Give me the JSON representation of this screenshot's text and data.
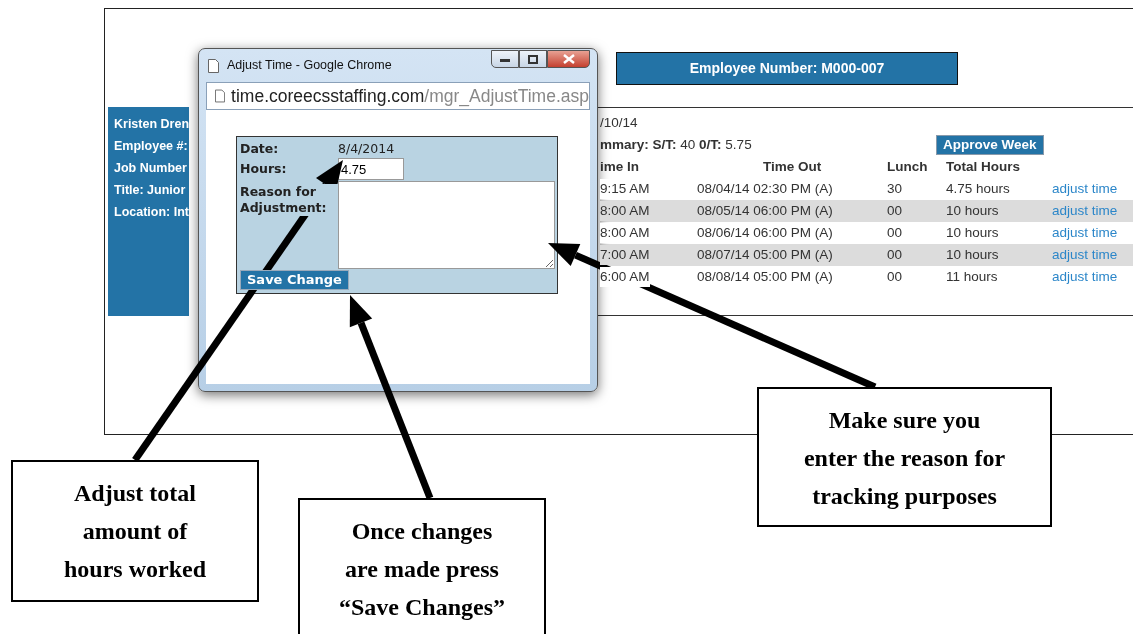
{
  "employee_number": "Employee Number: M000-007",
  "sidebar": {
    "lines": [
      "Kristen Dren",
      "Employee #:",
      "Job Number",
      "Title: Junior",
      "Location: Int"
    ]
  },
  "week": {
    "date_end": "/10/14",
    "summary": "**mmary: S/T:** 40 **0/T:** 5.75",
    "approve_button": "Approve Week",
    "columns": [
      "ime In",
      "Time Out",
      "Lunch",
      "Total Hours"
    ],
    "rows": [
      {
        "time_in": "9:15 AM",
        "time_out": "08/04/14 02:30 PM (A)",
        "lunch": "30",
        "total": "4.75 hours",
        "action": "adjust time"
      },
      {
        "time_in": "8:00 AM",
        "time_out": "08/05/14 06:00 PM (A)",
        "lunch": "00",
        "total": "10 hours",
        "action": "adjust time"
      },
      {
        "time_in": "8:00 AM",
        "time_out": "08/06/14 06:00 PM (A)",
        "lunch": "00",
        "total": "10 hours",
        "action": "adjust time"
      },
      {
        "time_in": "7:00 AM",
        "time_out": "08/07/14 05:00 PM (A)",
        "lunch": "00",
        "total": "10 hours",
        "action": "adjust time"
      },
      {
        "time_in": "6:00 AM",
        "time_out": "08/08/14 05:00 PM (A)",
        "lunch": "00",
        "total": "11 hours",
        "action": "adjust time"
      }
    ]
  },
  "popup": {
    "title": "Adjust Time - Google Chrome",
    "url_host": "time.coreecsstaffing.com",
    "url_path": "/mgr_AdjustTime.asp",
    "form": {
      "date_label": "Date:",
      "date_value": "8/4/2014",
      "hours_label": "Hours:",
      "hours_value": "4.75",
      "reason_label": "Reason for Adjustment:",
      "save_button": "Save Change"
    }
  },
  "callouts": [
    {
      "text": "Adjust total\namount of\nhours worked"
    },
    {
      "text": "Once changes\nare made press\n“Save Changes”"
    },
    {
      "text": "Make sure you\nenter the reason for\ntracking purposes"
    }
  ]
}
